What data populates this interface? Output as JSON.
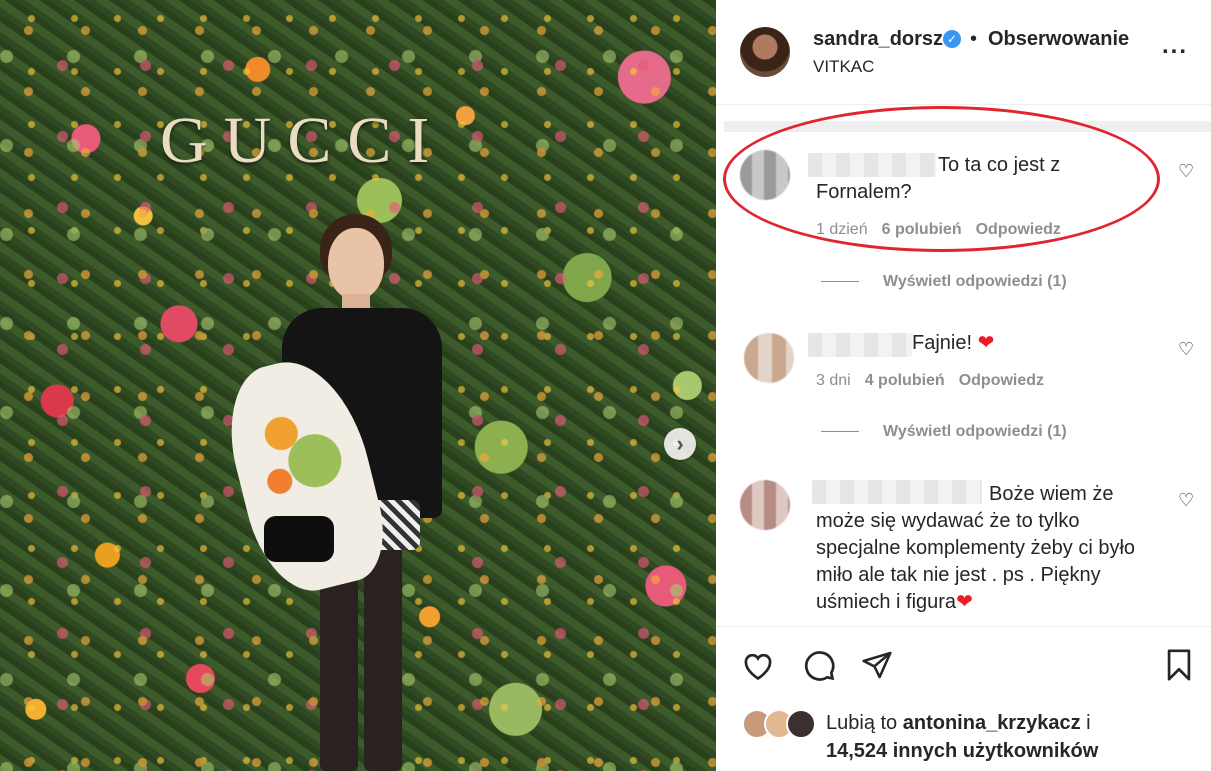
{
  "photo": {
    "brand_text": "GUCCI",
    "next_label": "›"
  },
  "header": {
    "username": "sandra_dorsz",
    "verified_mark": "✓",
    "separator": "•",
    "follow_label": "Obserwowanie",
    "location": "VITKAC",
    "more_label": "..."
  },
  "comments": [
    {
      "text": "To ta co jest z Fornalem?",
      "time": "1 dzień",
      "likes": "6 polubień",
      "reply": "Odpowiedz",
      "view_replies": "Wyświetl odpowiedzi (1)"
    },
    {
      "text": "Fajnie!",
      "emoji": "❤",
      "time": "3 dni",
      "likes": "4 polubień",
      "reply": "Odpowiedz",
      "view_replies": "Wyświetl odpowiedzi (1)"
    },
    {
      "text": "Boże wiem że może się wydawać że to tylko specjalne komplementy żeby ci było miło ale tak nie jest . ps . Piękny uśmiech i figura",
      "emoji": "❤"
    }
  ],
  "actions": {
    "like_icon": "heart-outline",
    "comment_icon": "speech-bubble",
    "share_icon": "paper-plane",
    "save_icon": "bookmark"
  },
  "likes": {
    "prefix": "Lubią to",
    "user": "antonina_krzykacz",
    "connector": "i",
    "count": "14,524 innych użytkowników"
  },
  "colors": {
    "highlight": "#e0252f",
    "verified": "#3897f0",
    "meta": "#8e8e8e"
  }
}
